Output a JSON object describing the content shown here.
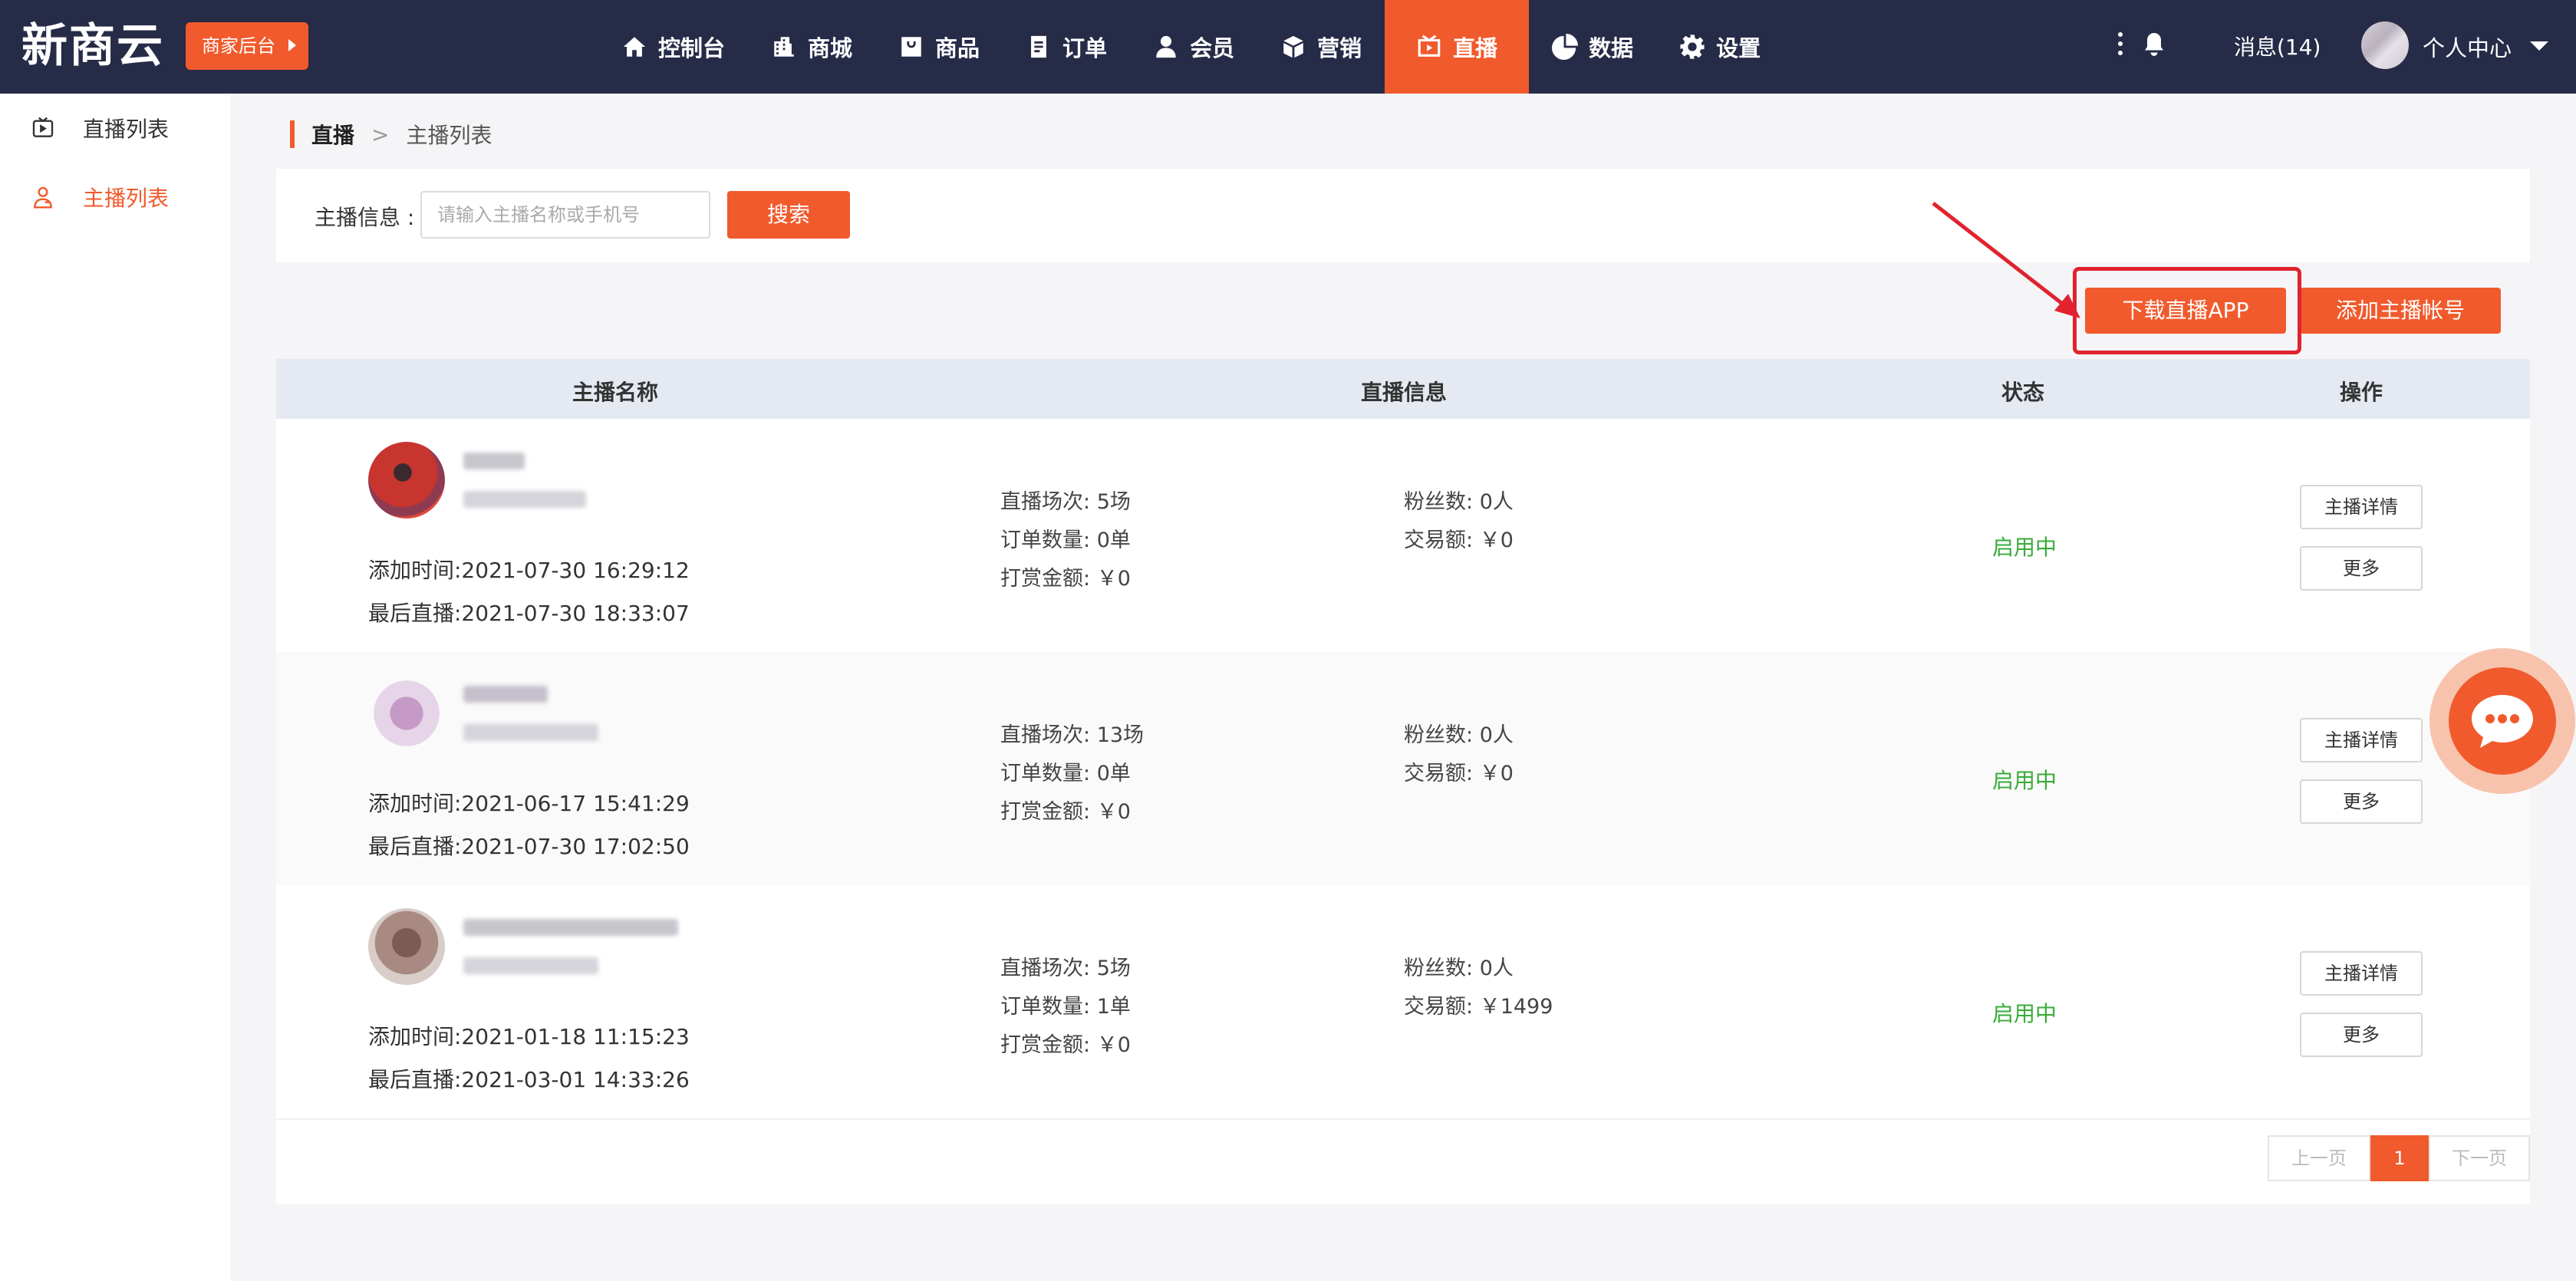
{
  "header": {
    "logo": "新商云",
    "merchant_button": "商家后台",
    "nav": [
      {
        "label": "控制台",
        "icon": "home-icon"
      },
      {
        "label": "商城",
        "icon": "building-icon"
      },
      {
        "label": "商品",
        "icon": "bag-icon"
      },
      {
        "label": "订单",
        "icon": "order-icon"
      },
      {
        "label": "会员",
        "icon": "user-icon"
      },
      {
        "label": "营销",
        "icon": "box-icon"
      },
      {
        "label": "直播",
        "icon": "live-icon",
        "active": true
      },
      {
        "label": "数据",
        "icon": "pie-chart-icon"
      },
      {
        "label": "设置",
        "icon": "gear-icon"
      }
    ],
    "messages": "消息(14)",
    "user_center": "个人中心"
  },
  "sidebar": {
    "items": [
      {
        "label": "直播列表",
        "icon": "live-list-icon",
        "active": false
      },
      {
        "label": "主播列表",
        "icon": "anchor-icon",
        "active": true
      }
    ]
  },
  "breadcrumb": {
    "parent": "直播",
    "separator": ">",
    "current": "主播列表"
  },
  "search": {
    "label": "主播信息 :",
    "placeholder": "请输入主播名称或手机号",
    "value": "",
    "button": "搜索"
  },
  "actions": {
    "download_app": "下载直播APP",
    "add_anchor": "添加主播帐号"
  },
  "table": {
    "headers": [
      "主播名称",
      "直播信息",
      "状态",
      "操作"
    ],
    "rows": [
      {
        "added": "添加时间:2021-07-30 16:29:12",
        "last_live": "最后直播:2021-07-30 18:33:07",
        "sessions_label": "直播场次:",
        "sessions": "5场",
        "orders_label": "订单数量:",
        "orders": "0单",
        "tips_label": "打赏金额:",
        "tips": "￥0",
        "fans_label": "粉丝数:",
        "fans": "0人",
        "trade_label": "交易额:",
        "trade": "￥0",
        "status": "启用中",
        "detail_button": "主播详情",
        "more_button": "更多"
      },
      {
        "added": "添加时间:2021-06-17 15:41:29",
        "last_live": "最后直播:2021-07-30 17:02:50",
        "sessions_label": "直播场次:",
        "sessions": "13场",
        "orders_label": "订单数量:",
        "orders": "0单",
        "tips_label": "打赏金额:",
        "tips": "￥0",
        "fans_label": "粉丝数:",
        "fans": "0人",
        "trade_label": "交易额:",
        "trade": "￥0",
        "status": "启用中",
        "detail_button": "主播详情",
        "more_button": "更多"
      },
      {
        "added": "添加时间:2021-01-18 11:15:23",
        "last_live": "最后直播:2021-03-01 14:33:26",
        "sessions_label": "直播场次:",
        "sessions": "5场",
        "orders_label": "订单数量:",
        "orders": "1单",
        "tips_label": "打赏金额:",
        "tips": "￥0",
        "fans_label": "粉丝数:",
        "fans": "0人",
        "trade_label": "交易额:",
        "trade": "￥1499",
        "status": "启用中",
        "detail_button": "主播详情",
        "more_button": "更多"
      }
    ]
  },
  "pagination": {
    "prev": "上一页",
    "current": "1",
    "next": "下一页"
  },
  "colors": {
    "accent": "#f15a2c",
    "topbar": "#262b47",
    "status_active": "#3aab3a",
    "highlight": "#e0232e"
  },
  "chat_fab_icon": "chat-bubble-icon"
}
